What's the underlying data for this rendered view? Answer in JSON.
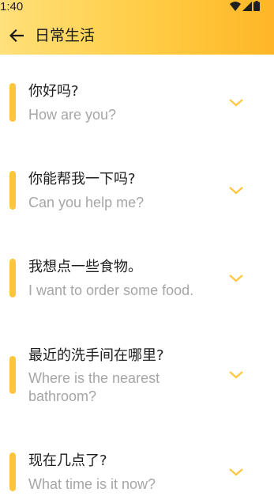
{
  "status_bar": {
    "time": "1:40"
  },
  "header": {
    "title": "日常生活"
  },
  "colors": {
    "accent": "#FFC53D",
    "header_start": "#FFE07A",
    "header_end": "#FFB627"
  },
  "phrases": [
    {
      "chinese": "你好吗?",
      "english": "How are you?"
    },
    {
      "chinese": "你能帮我一下吗?",
      "english": "Can you help me?"
    },
    {
      "chinese": "我想点一些食物。",
      "english": "I want to order some food."
    },
    {
      "chinese": "最近的洗手间在哪里?",
      "english": "Where is the nearest bathroom?"
    },
    {
      "chinese": "现在几点了?",
      "english": "What time is it now?"
    }
  ]
}
